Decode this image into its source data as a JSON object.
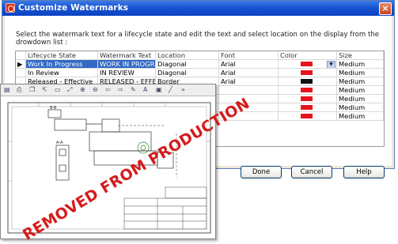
{
  "window": {
    "title": "Customize Watermarks",
    "close_symbol": "×"
  },
  "instruction": "Select the watermark text for a lifecycle state and edit the text and select location on the display from the drowdown list :",
  "grid": {
    "columns": [
      "Lifecycle State",
      "Watermark Text",
      "Location",
      "Font",
      "Color",
      "Size"
    ],
    "rows": [
      {
        "state": "Work In Progress",
        "text": "WORK IN PROGR...",
        "location": "Diagonal",
        "font": "Arial",
        "color": "#e8141b",
        "size": "Medium",
        "selected": true,
        "row_marker": "▶"
      },
      {
        "state": "In Review",
        "text": "IN REVIEW",
        "location": "Diagonal",
        "font": "Arial",
        "color": "#e8141b",
        "size": "Medium"
      },
      {
        "state": "Released - Effective",
        "text": "RELEASED - EFFE...",
        "location": "Border",
        "font": "Arial",
        "color": "#111111",
        "size": "Medium"
      },
      {
        "state": "",
        "text": "",
        "location": "",
        "font": "",
        "color": "#e8141b",
        "size": "Medium"
      },
      {
        "state": "",
        "text": "",
        "location": "",
        "font": "",
        "color": "#e8141b",
        "size": "Medium"
      },
      {
        "state": "",
        "text": "",
        "location": "",
        "font": "",
        "color": "#e8141b",
        "size": "Medium"
      },
      {
        "state": "",
        "text": "",
        "location": "",
        "font": "",
        "color": "#e8141b",
        "size": "Medium"
      }
    ]
  },
  "buttons": {
    "done": "Done",
    "cancel": "Cancel",
    "help": "Help"
  },
  "preview": {
    "toolbar_icons": [
      "save-icon",
      "print-icon",
      "copy-icon",
      "pointer-icon",
      "select-icon",
      "zoom-fit-icon",
      "zoom-in-icon",
      "zoom-out-icon",
      "back-icon",
      "forward-icon",
      "pen-icon",
      "text-icon",
      "stamp-icon",
      "line-icon",
      "more-icon"
    ],
    "toolbar_glyphs": {
      "text": "A",
      "more": "»"
    },
    "watermark": "REMOVED FROM PRODUCTION",
    "watermark_color": "#d31c1c",
    "view_labels": {
      "top": "B-B",
      "middle": "A-A"
    }
  }
}
